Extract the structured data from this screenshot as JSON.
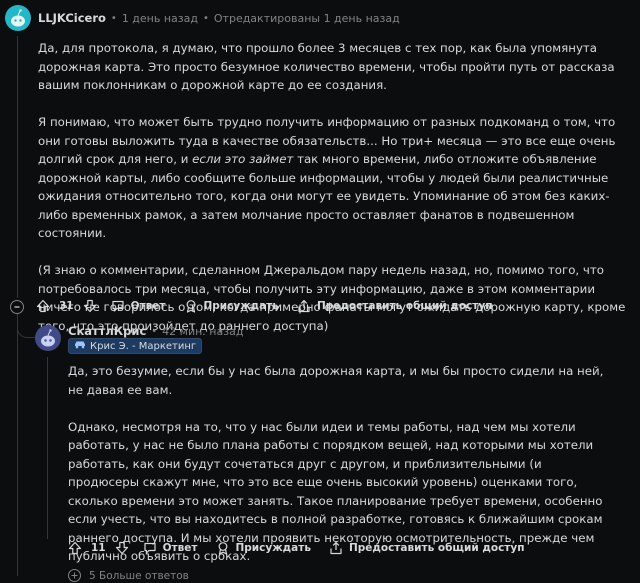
{
  "comment": {
    "author": "LLJKCicero",
    "time": "1 день назад",
    "edited": "Отредактированы 1 день назад",
    "paragraphs": {
      "p1": "Да, для протокола, я думаю, что прошло более 3 месяцев с тех пор, как была упомянута дорожная карта. Это просто безумное количество времени, чтобы пройти путь от рассказа вашим поклонникам о дорожной карте до ее создания.",
      "p2a": "Я понимаю, что может быть трудно получить информацию от разных подкоманд о том, что они готовы выложить туда в качестве обязательств... Но три+ месяца — это все еще очень долгий срок для него, и ",
      "p2em": "если это займет",
      "p2b": " так много времени, либо отложите объявление дорожной карты, либо сообщите больше информации, чтобы у людей были реалистичные ожидания относительно того, когда они могут ее увидеть. Упоминание об этом без каких-либо временных рамок, а затем молчание просто оставляет фанатов в подвешенном состоянии.",
      "p3": "(Я знаю о комментарии, сделанном Джеральдом пару недель назад, но, помимо того, что потребовалось три месяца, чтобы получить эту информацию, даже в этом комментарии ничего не говорилось о том, когда примерно фанаты могут ожидать дорожную карту, кроме того, что это произойдет до раннего доступа)"
    },
    "score": "31",
    "reply_label": "Ответ",
    "award_label": "Присуждать",
    "share_label": "Предоставить общий доступ"
  },
  "reply": {
    "author": "СкаттлКрис",
    "time": "42 мин. назад",
    "flair": "Крис Э. - Маркетинг",
    "paragraphs": {
      "p1": "Да, это безумие, если бы у нас была дорожная карта, и мы бы просто сидели на ней, не давая ее вам.",
      "p2": "Однако, несмотря на то, что у нас были идеи и темы работы, над чем мы хотели работать, у нас не было плана работы с порядком вещей, над которыми мы хотели работать, как они будут сочетаться друг с другом, и приблизительными (и продюсеры скажут мне, что это все еще очень высокий уровень) оценками того, сколько времени это может занять. Такое планирование требует времени, особенно если учесть, что вы находитесь в полной разработке, готовясь к ближайшим срокам раннего доступа. И мы хотели проявить некоторую осмотрительность, прежде чем публично объявить о сроках."
    },
    "score": "11",
    "reply_label": "Ответ",
    "award_label": "Присуждать",
    "share_label": "Предоставить общий доступ"
  },
  "more_replies": "5 Больше ответов",
  "colors": {
    "background": "#0b0d0e",
    "text": "#d7dadc",
    "muted": "#818384",
    "flair": "#1f3a5f",
    "avatar_1": "#23b8c9",
    "avatar_2": "#3f4a86"
  }
}
